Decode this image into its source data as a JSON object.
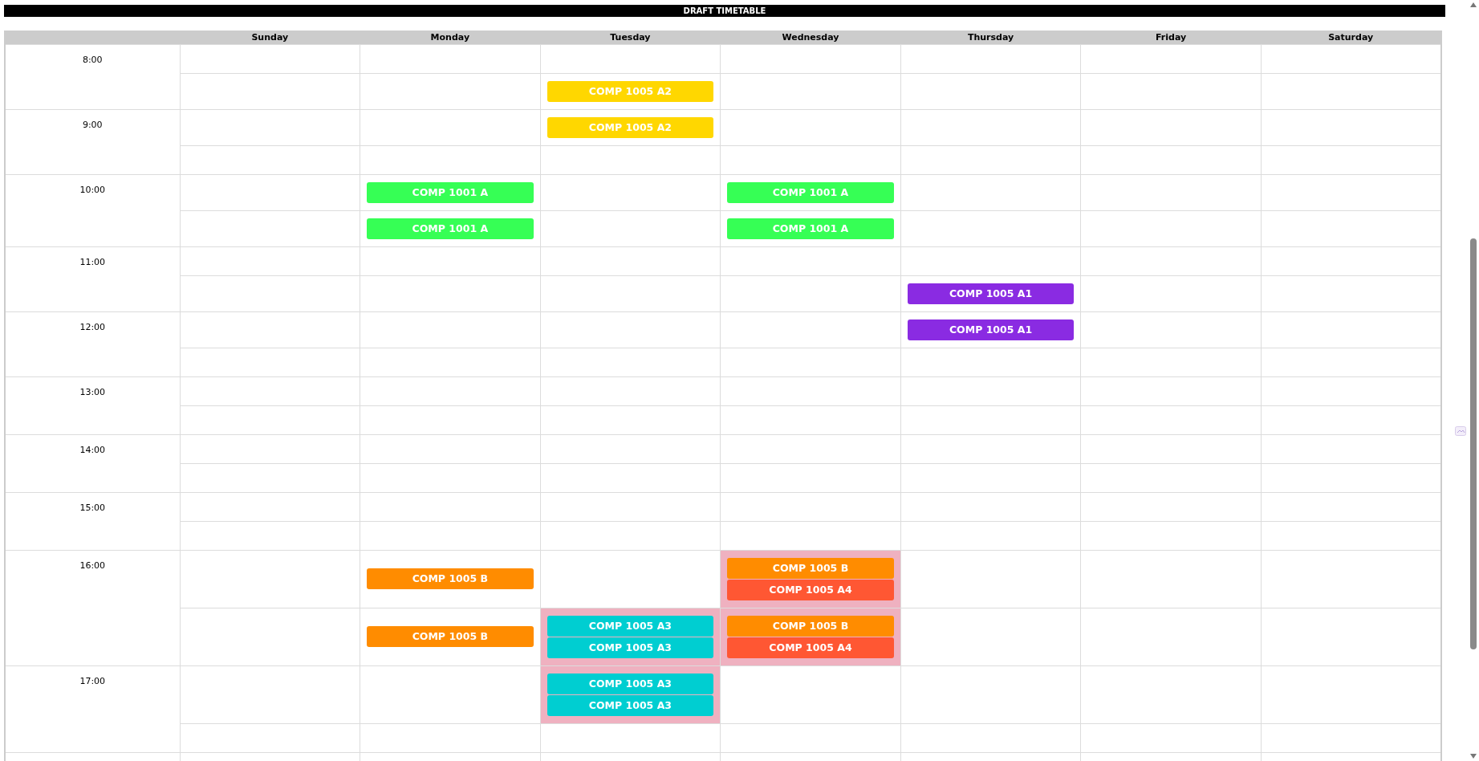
{
  "title": "DRAFT TIMETABLE",
  "days": [
    "Sunday",
    "Monday",
    "Tuesday",
    "Wednesday",
    "Thursday",
    "Friday",
    "Saturday"
  ],
  "slots": [
    {
      "kind": "hour",
      "time": "8:00",
      "cells": [
        {
          "conflict": false
        },
        {
          "conflict": false
        },
        {
          "conflict": false
        },
        {
          "conflict": false
        },
        {
          "conflict": false
        },
        {
          "conflict": false
        },
        {
          "conflict": false
        }
      ]
    },
    {
      "kind": "half",
      "cells": [
        {
          "conflict": false
        },
        {
          "conflict": false
        },
        {
          "conflict": false,
          "events": [
            {
              "label": "COMP 1005 A2",
              "color": "#ffd700"
            }
          ]
        },
        {
          "conflict": false
        },
        {
          "conflict": false
        },
        {
          "conflict": false
        },
        {
          "conflict": false
        }
      ]
    },
    {
      "kind": "hour",
      "time": "9:00",
      "cells": [
        {
          "conflict": false
        },
        {
          "conflict": false
        },
        {
          "conflict": false,
          "events": [
            {
              "label": "COMP 1005 A2",
              "color": "#ffd700"
            }
          ]
        },
        {
          "conflict": false
        },
        {
          "conflict": false
        },
        {
          "conflict": false
        },
        {
          "conflict": false
        }
      ]
    },
    {
      "kind": "half",
      "cells": [
        {
          "conflict": false
        },
        {
          "conflict": false
        },
        {
          "conflict": false
        },
        {
          "conflict": false
        },
        {
          "conflict": false
        },
        {
          "conflict": false
        },
        {
          "conflict": false
        }
      ]
    },
    {
      "kind": "hour",
      "time": "10:00",
      "cells": [
        {
          "conflict": false
        },
        {
          "conflict": false,
          "events": [
            {
              "label": "COMP 1001 A",
              "color": "#36ff55"
            }
          ]
        },
        {
          "conflict": false
        },
        {
          "conflict": false,
          "events": [
            {
              "label": "COMP 1001 A",
              "color": "#36ff55"
            }
          ]
        },
        {
          "conflict": false
        },
        {
          "conflict": false
        },
        {
          "conflict": false
        }
      ]
    },
    {
      "kind": "half",
      "cells": [
        {
          "conflict": false
        },
        {
          "conflict": false,
          "events": [
            {
              "label": "COMP 1001 A",
              "color": "#36ff55"
            }
          ]
        },
        {
          "conflict": false
        },
        {
          "conflict": false,
          "events": [
            {
              "label": "COMP 1001 A",
              "color": "#36ff55"
            }
          ]
        },
        {
          "conflict": false
        },
        {
          "conflict": false
        },
        {
          "conflict": false
        }
      ]
    },
    {
      "kind": "hour",
      "time": "11:00",
      "cells": [
        {
          "conflict": false
        },
        {
          "conflict": false
        },
        {
          "conflict": false
        },
        {
          "conflict": false
        },
        {
          "conflict": false
        },
        {
          "conflict": false
        },
        {
          "conflict": false
        }
      ]
    },
    {
      "kind": "half",
      "cells": [
        {
          "conflict": false
        },
        {
          "conflict": false
        },
        {
          "conflict": false
        },
        {
          "conflict": false
        },
        {
          "conflict": false,
          "events": [
            {
              "label": "COMP 1005 A1",
              "color": "#8a2be2"
            }
          ]
        },
        {
          "conflict": false
        },
        {
          "conflict": false
        }
      ]
    },
    {
      "kind": "hour",
      "time": "12:00",
      "cells": [
        {
          "conflict": false
        },
        {
          "conflict": false
        },
        {
          "conflict": false
        },
        {
          "conflict": false
        },
        {
          "conflict": false,
          "events": [
            {
              "label": "COMP 1005 A1",
              "color": "#8a2be2"
            }
          ]
        },
        {
          "conflict": false
        },
        {
          "conflict": false
        }
      ]
    },
    {
      "kind": "half",
      "cells": [
        {
          "conflict": false
        },
        {
          "conflict": false
        },
        {
          "conflict": false
        },
        {
          "conflict": false
        },
        {
          "conflict": false
        },
        {
          "conflict": false
        },
        {
          "conflict": false
        }
      ]
    },
    {
      "kind": "hour",
      "time": "13:00",
      "cells": [
        {
          "conflict": false
        },
        {
          "conflict": false
        },
        {
          "conflict": false
        },
        {
          "conflict": false
        },
        {
          "conflict": false
        },
        {
          "conflict": false
        },
        {
          "conflict": false
        }
      ]
    },
    {
      "kind": "half",
      "cells": [
        {
          "conflict": false
        },
        {
          "conflict": false
        },
        {
          "conflict": false
        },
        {
          "conflict": false
        },
        {
          "conflict": false
        },
        {
          "conflict": false
        },
        {
          "conflict": false
        }
      ]
    },
    {
      "kind": "hour",
      "time": "14:00",
      "cells": [
        {
          "conflict": false
        },
        {
          "conflict": false
        },
        {
          "conflict": false
        },
        {
          "conflict": false
        },
        {
          "conflict": false
        },
        {
          "conflict": false
        },
        {
          "conflict": false
        }
      ]
    },
    {
      "kind": "half",
      "cells": [
        {
          "conflict": false
        },
        {
          "conflict": false
        },
        {
          "conflict": false
        },
        {
          "conflict": false
        },
        {
          "conflict": false
        },
        {
          "conflict": false
        },
        {
          "conflict": false
        }
      ]
    },
    {
      "kind": "hour",
      "time": "15:00",
      "cells": [
        {
          "conflict": false
        },
        {
          "conflict": false
        },
        {
          "conflict": false
        },
        {
          "conflict": false
        },
        {
          "conflict": false
        },
        {
          "conflict": false
        },
        {
          "conflict": false
        }
      ]
    },
    {
      "kind": "half",
      "cells": [
        {
          "conflict": false
        },
        {
          "conflict": false
        },
        {
          "conflict": false
        },
        {
          "conflict": false
        },
        {
          "conflict": false
        },
        {
          "conflict": false
        },
        {
          "conflict": false
        }
      ]
    },
    {
      "kind": "hour",
      "time": "16:00",
      "cells": [
        {
          "conflict": false
        },
        {
          "conflict": false,
          "events": [
            {
              "label": "COMP 1005 B",
              "color": "#ff8c00"
            }
          ]
        },
        {
          "conflict": false
        },
        {
          "conflict": true,
          "events": [
            {
              "label": "COMP 1005 B",
              "color": "#ff8c00"
            },
            {
              "label": "COMP 1005 A4",
              "color": "#ff5733"
            }
          ]
        },
        {
          "conflict": false
        },
        {
          "conflict": false
        },
        {
          "conflict": false
        }
      ]
    },
    {
      "kind": "half",
      "cells": [
        {
          "conflict": false
        },
        {
          "conflict": false,
          "events": [
            {
              "label": "COMP 1005 B",
              "color": "#ff8c00"
            }
          ]
        },
        {
          "conflict": true,
          "events": [
            {
              "label": "COMP 1005 A3",
              "color": "#00ced1"
            },
            {
              "label": "COMP 1005 A3",
              "color": "#00ced1"
            }
          ]
        },
        {
          "conflict": true,
          "events": [
            {
              "label": "COMP 1005 B",
              "color": "#ff8c00"
            },
            {
              "label": "COMP 1005 A4",
              "color": "#ff5733"
            }
          ]
        },
        {
          "conflict": false
        },
        {
          "conflict": false
        },
        {
          "conflict": false
        }
      ]
    },
    {
      "kind": "hour",
      "time": "17:00",
      "cells": [
        {
          "conflict": false
        },
        {
          "conflict": false
        },
        {
          "conflict": true,
          "events": [
            {
              "label": "COMP 1005 A3",
              "color": "#00ced1"
            },
            {
              "label": "COMP 1005 A3",
              "color": "#00ced1"
            }
          ]
        },
        {
          "conflict": false
        },
        {
          "conflict": false
        },
        {
          "conflict": false
        },
        {
          "conflict": false
        }
      ]
    },
    {
      "kind": "half",
      "cells": [
        {
          "conflict": false
        },
        {
          "conflict": false
        },
        {
          "conflict": false
        },
        {
          "conflict": false
        },
        {
          "conflict": false
        },
        {
          "conflict": false
        },
        {
          "conflict": false
        }
      ]
    },
    {
      "kind": "hour",
      "cells": [
        {
          "conflict": false
        },
        {
          "conflict": false
        },
        {
          "conflict": false
        },
        {
          "conflict": false
        },
        {
          "conflict": false
        },
        {
          "conflict": false
        },
        {
          "conflict": false
        }
      ]
    }
  ]
}
